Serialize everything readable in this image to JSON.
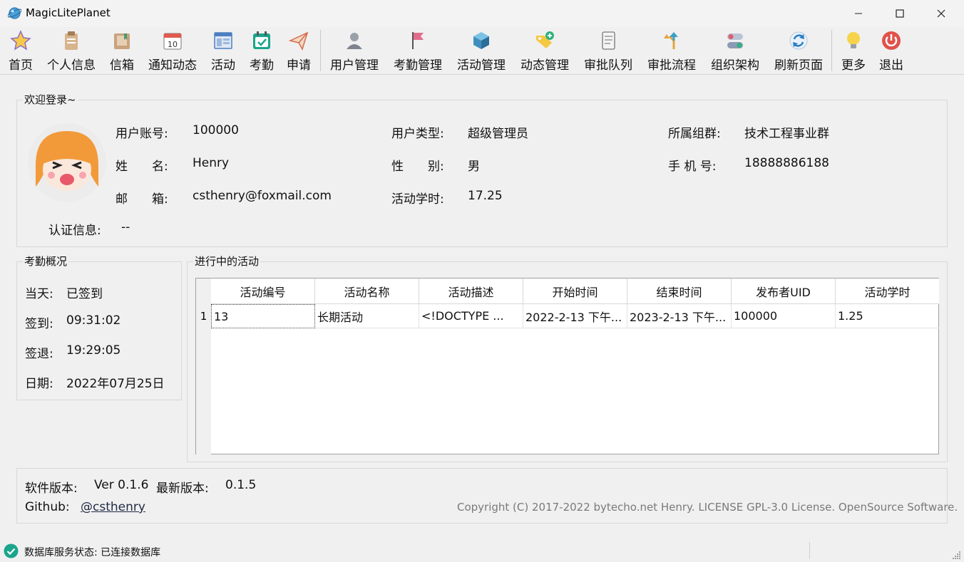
{
  "window": {
    "title": "MagicLitePlanet"
  },
  "toolbar": {
    "items": [
      {
        "label": "首页",
        "icon": "star-icon"
      },
      {
        "label": "个人信息",
        "icon": "clipboard-icon"
      },
      {
        "label": "信箱",
        "icon": "mailbox-icon"
      },
      {
        "label": "通知动态",
        "icon": "calendar-icon"
      },
      {
        "label": "活动",
        "icon": "window-icon"
      },
      {
        "label": "考勤",
        "icon": "check-calendar-icon"
      },
      {
        "label": "申请",
        "icon": "paper-plane-icon"
      },
      {
        "label": "用户管理",
        "icon": "user-icon"
      },
      {
        "label": "考勤管理",
        "icon": "flag-icon"
      },
      {
        "label": "活动管理",
        "icon": "cube-icon"
      },
      {
        "label": "动态管理",
        "icon": "tag-plus-icon"
      },
      {
        "label": "审批队列",
        "icon": "scroll-icon"
      },
      {
        "label": "审批流程",
        "icon": "flow-arrow-icon"
      },
      {
        "label": "组织架构",
        "icon": "toggle-icon"
      },
      {
        "label": "刷新页面",
        "icon": "refresh-icon"
      },
      {
        "label": "更多",
        "icon": "bulb-icon"
      },
      {
        "label": "退出",
        "icon": "power-icon"
      }
    ],
    "calendar_day": "10"
  },
  "welcome": {
    "title": "欢迎登录~",
    "account_label": "用户账号:",
    "account": "100000",
    "type_label": "用户类型:",
    "type": "超级管理员",
    "group_label": "所属组群:",
    "group": "技术工程事业群",
    "name_label": "姓　　名:",
    "name": "Henry",
    "gender_label": "性　　别:",
    "gender": "男",
    "phone_label": "手 机 号:",
    "phone": "18888886188",
    "email_label": "邮　　箱:",
    "email": "csthenry@foxmail.com",
    "hours_label": "活动学时:",
    "hours": "17.25",
    "cert_label": "认证信息:",
    "cert": "--"
  },
  "attendance": {
    "title": "考勤概况",
    "today_label": "当天:",
    "today": "已签到",
    "signin_label": "签到:",
    "signin": "09:31:02",
    "signout_label": "签退:",
    "signout": "19:29:05",
    "date_label": "日期:",
    "date": "2022年07月25日"
  },
  "activities": {
    "title": "进行中的活动",
    "columns": [
      "活动编号",
      "活动名称",
      "活动描述",
      "开始时间",
      "结束时间",
      "发布者UID",
      "活动学时"
    ],
    "rows": [
      {
        "num": "1",
        "cells": [
          "13",
          "长期活动",
          "<!DOCTYPE ...",
          "2022-2-13 下午...",
          "2023-2-13 下午...",
          "100000",
          "1.25"
        ]
      }
    ]
  },
  "footer": {
    "version_label": "软件版本:",
    "version": "Ver 0.1.6",
    "latest_label": "最新版本:",
    "latest": "0.1.5",
    "github_label": "Github:",
    "github_link": "@csthenry",
    "copyright": "Copyright (C) 2017-2022 bytecho.net Henry. LICENSE GPL-3.0 License. OpenSource Software."
  },
  "status": {
    "text": "数据库服务状态: 已连接数据库"
  },
  "colors": {
    "accent": "#1aa58c",
    "close_red": "#e0524b",
    "link": "#1f4e8c"
  }
}
